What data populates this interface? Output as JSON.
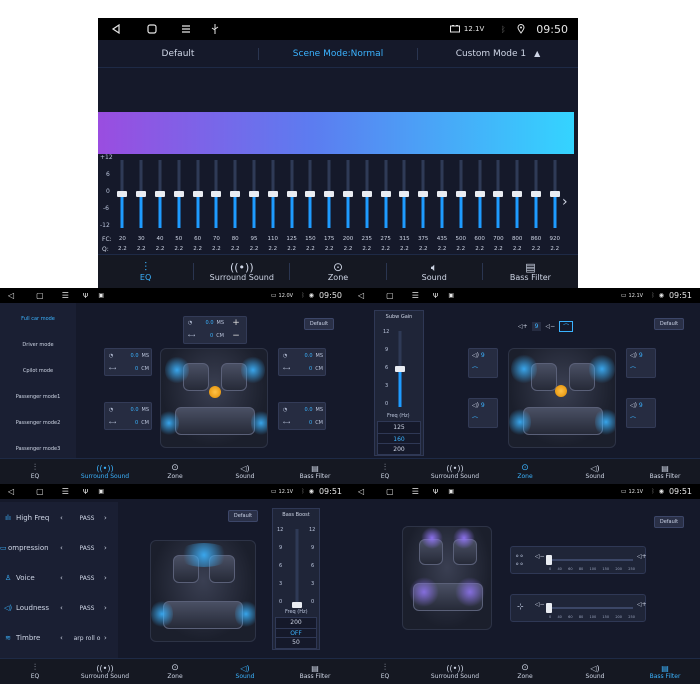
{
  "colors": {
    "accent": "#3bb3ff",
    "background": "#15192a",
    "status_bg": "#000000",
    "gradient_left": "#9a4de0",
    "gradient_right": "#34d4ff"
  },
  "top": {
    "status": {
      "voltage": "12.1V",
      "time": "09:50",
      "icons": [
        "back-icon",
        "home-icon",
        "menu-icon",
        "usb-icon",
        "battery-icon",
        "bluetooth-icon",
        "location-icon"
      ]
    },
    "header": {
      "left": "Default",
      "center": "Scene Mode:Normal",
      "right": "Custom Mode 1"
    },
    "eq": {
      "y_ticks": [
        "+12",
        "6",
        "0",
        "-6",
        "-12"
      ],
      "fc_label": "FC:",
      "q_label": "Q:",
      "freqs": [
        "20",
        "30",
        "40",
        "50",
        "60",
        "70",
        "80",
        "95",
        "110",
        "125",
        "150",
        "175",
        "200",
        "235",
        "275",
        "315",
        "375",
        "435",
        "500",
        "600",
        "700",
        "800",
        "860",
        "920"
      ],
      "qs": [
        "2.2",
        "2.2",
        "2.2",
        "2.2",
        "2.2",
        "2.2",
        "2.2",
        "2.2",
        "2.2",
        "2.2",
        "2.2",
        "2.2",
        "2.2",
        "2.2",
        "2.2",
        "2.2",
        "2.2",
        "2.2",
        "2.2",
        "2.2",
        "2.2",
        "2.2",
        "2.2",
        "2.2"
      ],
      "gains_db": [
        0,
        0,
        0,
        0,
        0,
        0,
        0,
        0,
        0,
        0,
        0,
        0,
        0,
        0,
        0,
        0,
        0,
        0,
        0,
        0,
        0,
        0,
        0,
        0
      ]
    }
  },
  "nav": {
    "items": [
      {
        "label": "EQ",
        "icon": "eq-icon"
      },
      {
        "label": "Surround Sound",
        "icon": "surround-icon"
      },
      {
        "label": "Zone",
        "icon": "zone-icon"
      },
      {
        "label": "Sound",
        "icon": "speaker-icon"
      },
      {
        "label": "Bass Filter",
        "icon": "bass-filter-icon"
      }
    ]
  },
  "p2": {
    "status": {
      "voltage": "12.0V",
      "time": "09:50"
    },
    "menu": [
      "Full car mode",
      "Driver mode",
      "Cpilot mode",
      "Passenger mode1",
      "Passenger mode2",
      "Passenger mode3"
    ],
    "default_btn": "Default",
    "delay_unit_ms": "MS",
    "delay_unit_cm": "CM",
    "delays": [
      {
        "ms": "0.0",
        "cm": "0"
      },
      {
        "ms": "0.0",
        "cm": "0"
      },
      {
        "ms": "0.0",
        "cm": "0"
      },
      {
        "ms": "0.0",
        "cm": "0"
      },
      {
        "ms": "0.0",
        "cm": "0"
      }
    ],
    "plus": "+",
    "minus": "−"
  },
  "p3": {
    "status": {
      "voltage": "12.1V",
      "time": "09:51"
    },
    "subw_title": "Subw Gain",
    "ticks": [
      "12",
      "9",
      "6",
      "3",
      "0"
    ],
    "freq_label": "Freq (Hz)",
    "freq_options": [
      "125",
      "160",
      "200"
    ],
    "freq_selected": "160",
    "gain_value": 6,
    "default_btn": "Default",
    "speaker_values": [
      "9",
      "9",
      "9",
      "9",
      "9"
    ]
  },
  "p4": {
    "status": {
      "voltage": "12.1V",
      "time": "09:51"
    },
    "rows": [
      {
        "label": "High Freq",
        "value": "PASS",
        "icon": "high-freq-icon"
      },
      {
        "label": "ompression",
        "value": "PASS",
        "icon": "compression-icon"
      },
      {
        "label": "Voice",
        "value": "PASS",
        "icon": "voice-icon"
      },
      {
        "label": "Loudness",
        "value": "PASS",
        "icon": "loudness-icon"
      },
      {
        "label": "Timbre",
        "value": "arp roll o",
        "icon": "timbre-icon"
      }
    ],
    "default_btn": "Default",
    "bass_title": "Bass Boost",
    "ticks": [
      "12",
      "9",
      "6",
      "3",
      "0"
    ],
    "freq_label": "Freq (Hz)",
    "freq_options": [
      "200",
      "OFF",
      "50"
    ],
    "freq_selected": "OFF",
    "boost_value": 0
  },
  "p5": {
    "status": {
      "voltage": "12.1V",
      "time": "09:51"
    },
    "default_btn": "Default",
    "scale": [
      "0",
      "40",
      "60",
      "80",
      "100",
      "150",
      "200",
      "250"
    ],
    "slider_values": [
      0,
      0
    ]
  }
}
